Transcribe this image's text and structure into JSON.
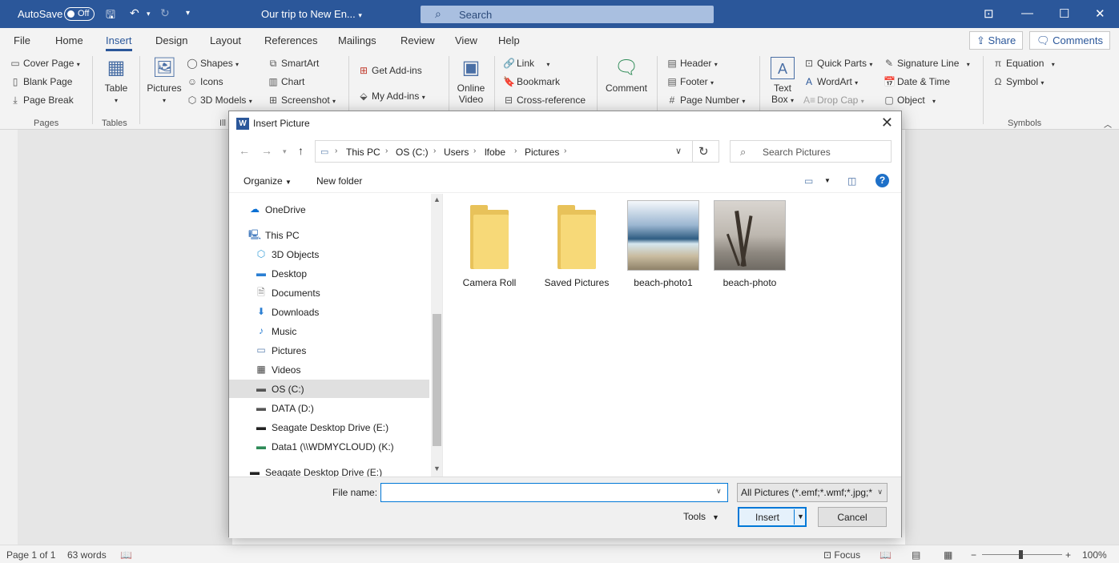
{
  "titlebar": {
    "autosave_label": "AutoSave",
    "autosave_state": "Off",
    "doc_title": "Our trip to New En...",
    "search_placeholder": "Search"
  },
  "tabs": {
    "file": "File",
    "home": "Home",
    "insert": "Insert",
    "design": "Design",
    "layout": "Layout",
    "references": "References",
    "mailings": "Mailings",
    "review": "Review",
    "view": "View",
    "help": "Help",
    "share": "Share",
    "comments": "Comments"
  },
  "ribbon": {
    "cover_page": "Cover Page",
    "blank_page": "Blank Page",
    "page_break": "Page Break",
    "pages_group": "Pages",
    "table": "Table",
    "tables_group": "Tables",
    "pictures": "Pictures",
    "shapes": "Shapes",
    "icons": "Icons",
    "models_3d": "3D Models",
    "smartart": "SmartArt",
    "chart": "Chart",
    "screenshot": "Screenshot",
    "illustrations_group": "Ill",
    "get_addins": "Get Add-ins",
    "my_addins": "My Add-ins",
    "online_video_1": "Online",
    "online_video_2": "Video",
    "link": "Link",
    "bookmark": "Bookmark",
    "cross_reference": "Cross-reference",
    "comment": "Comment",
    "header": "Header",
    "footer": "Footer",
    "page_number": "Page Number",
    "text_box_1": "Text",
    "text_box_2": "Box",
    "quick_parts": "Quick Parts",
    "wordart": "WordArt",
    "drop_cap": "Drop Cap",
    "signature_line": "Signature Line",
    "date_time": "Date & Time",
    "object": "Object",
    "equation": "Equation",
    "symbol": "Symbol",
    "symbols_group": "Symbols"
  },
  "dialog": {
    "title": "Insert Picture",
    "breadcrumb": [
      "This PC",
      "OS (C:)",
      "Users",
      "lfobe",
      "Pictures"
    ],
    "search_placeholder": "Search Pictures",
    "organize": "Organize",
    "new_folder": "New folder",
    "help": "?",
    "nav": [
      {
        "label": "OneDrive",
        "icon": "cloud-icon"
      },
      {
        "label": "This PC",
        "icon": "computer-icon"
      },
      {
        "label": "3D Objects",
        "icon": "cube-icon"
      },
      {
        "label": "Desktop",
        "icon": "desktop-icon"
      },
      {
        "label": "Documents",
        "icon": "document-icon"
      },
      {
        "label": "Downloads",
        "icon": "download-icon"
      },
      {
        "label": "Music",
        "icon": "music-icon"
      },
      {
        "label": "Pictures",
        "icon": "pictures-icon"
      },
      {
        "label": "Videos",
        "icon": "video-icon"
      },
      {
        "label": "OS (C:)",
        "icon": "drive-icon"
      },
      {
        "label": "DATA (D:)",
        "icon": "drive-icon"
      },
      {
        "label": "Seagate Desktop Drive (E:)",
        "icon": "drive-icon"
      },
      {
        "label": "Data1 (\\\\WDMYCLOUD) (K:)",
        "icon": "network-drive-icon"
      },
      {
        "label": "Seagate Desktop Drive (E:)",
        "icon": "drive-icon"
      }
    ],
    "files": [
      {
        "name": "Camera Roll",
        "type": "folder"
      },
      {
        "name": "Saved Pictures",
        "type": "folder"
      },
      {
        "name": "beach-photo1",
        "type": "image"
      },
      {
        "name": "beach-photo",
        "type": "image"
      }
    ],
    "file_name_label": "File name:",
    "file_name_value": "",
    "filter": "All Pictures (*.emf;*.wmf;*.jpg;*",
    "tools": "Tools",
    "insert": "Insert",
    "cancel": "Cancel"
  },
  "statusbar": {
    "page": "Page 1 of 1",
    "words": "63 words",
    "focus": "Focus",
    "zoom": "100%"
  },
  "colors": {
    "word_blue": "#2b579a",
    "accent": "#0078d7"
  }
}
